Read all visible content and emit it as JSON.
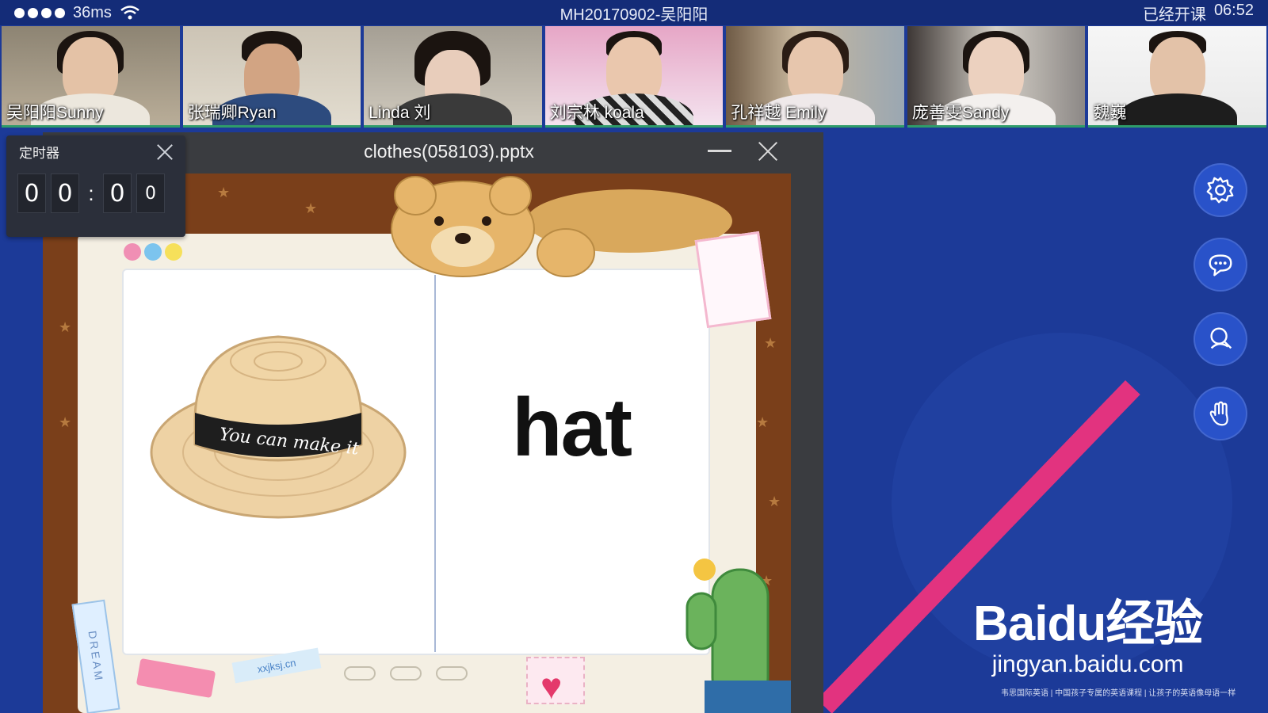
{
  "status_bar": {
    "latency": "36ms",
    "meeting_title": "MH20170902-吴阳阳",
    "elapsed_label": "已经开课",
    "elapsed_time": "06:52"
  },
  "participants": [
    {
      "name": "吴阳阳Sunny"
    },
    {
      "name": "张瑞卿Ryan"
    },
    {
      "name": "Linda 刘"
    },
    {
      "name": "刘宗林 koala"
    },
    {
      "name": "孔祥越  Emily"
    },
    {
      "name": "庞善雯Sandy"
    },
    {
      "name": "魏巍"
    }
  ],
  "timer": {
    "title": "定时器",
    "digits": [
      "0",
      "0",
      "0",
      "0"
    ],
    "separator": ":"
  },
  "ppt": {
    "filename": "clothes(058103).pptx",
    "slide_word": "hat",
    "hat_text": "You can make it",
    "sticker_dream": "DREAM",
    "sticker_site": "xxjksj.cn"
  },
  "side_buttons": [
    "gear-icon",
    "chat-icon",
    "question-icon",
    "hand-raise-icon"
  ],
  "watermark": {
    "brand_a": "Bai",
    "brand_b": "du",
    "brand_c": "经验",
    "url": "jingyan.baidu.com",
    "slogan": "韦思国际英语 | 中国孩子专属的英语课程 | 让孩子的英语像母语一样"
  },
  "colors": {
    "background": "#1c3a98",
    "accent_pink": "#e2337f",
    "slide_frame": "#7a3f1a"
  }
}
